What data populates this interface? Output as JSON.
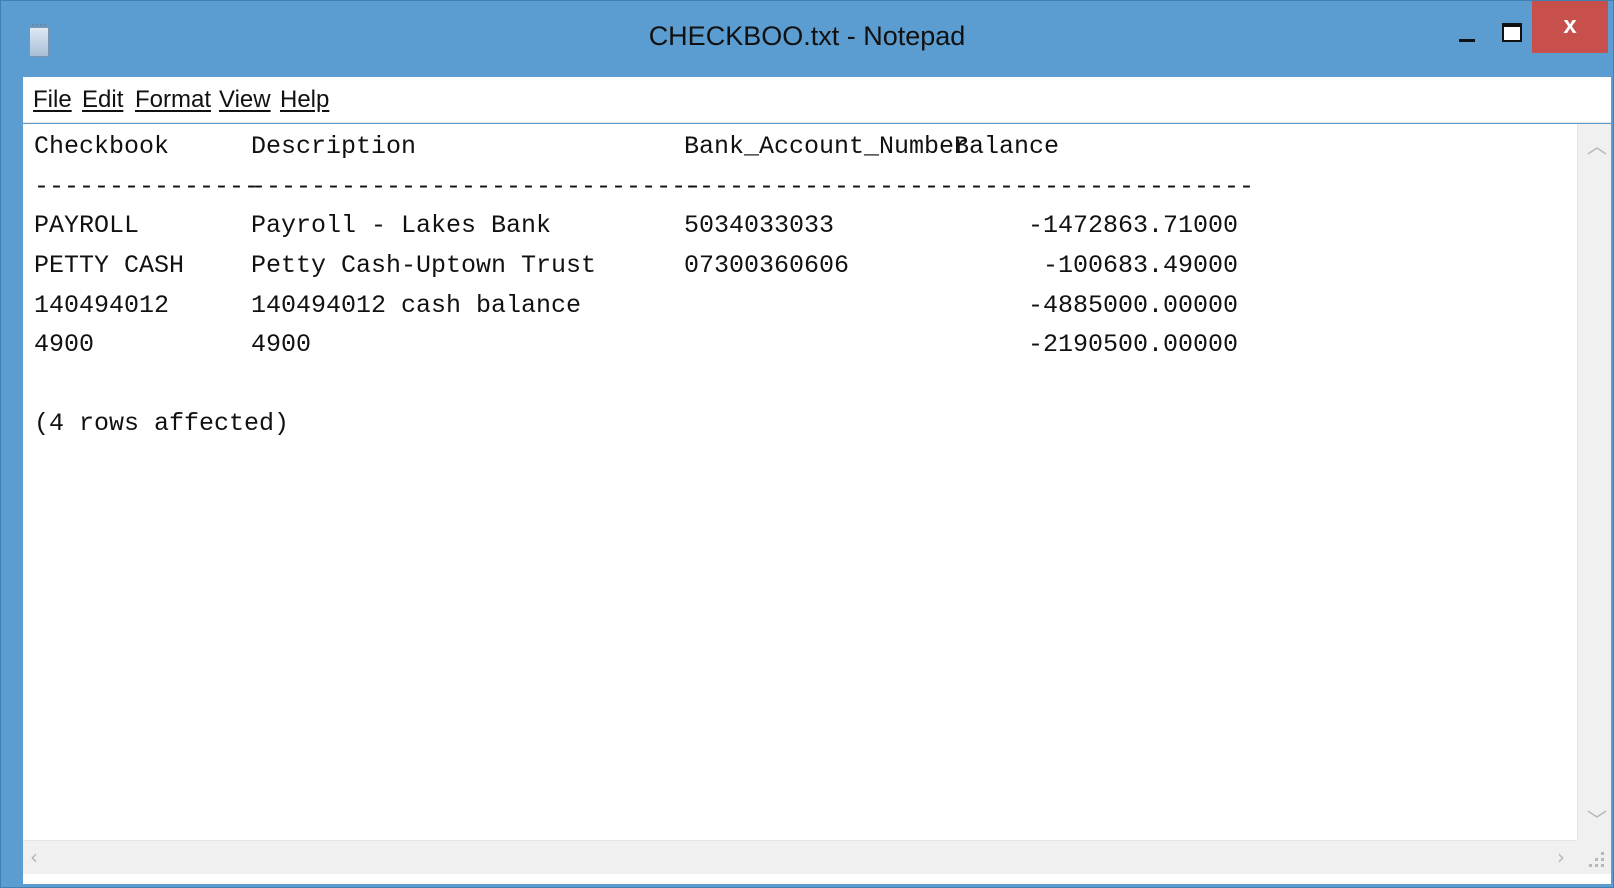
{
  "window": {
    "title": "CHECKBOO.txt - Notepad",
    "close_label": "x"
  },
  "menu": {
    "file": "File",
    "edit": "Edit",
    "format": "Format",
    "view": "View",
    "help": "Help"
  },
  "document": {
    "headers": {
      "checkbook": "Checkbook",
      "description": "Description",
      "bank_account_number": "Bank_Account_Number",
      "balance": "Balance"
    },
    "separators": {
      "checkbook": "---------------",
      "description": "------------------------------",
      "bank_account_number": "-------------------",
      "balance": "--------------------"
    },
    "rows": [
      {
        "checkbook": "PAYROLL",
        "description": "Payroll - Lakes Bank",
        "bank_account_number": "5034033033",
        "balance": "-1472863.71000"
      },
      {
        "checkbook": "PETTY CASH",
        "description": "Petty Cash-Uptown Trust",
        "bank_account_number": "07300360606",
        "balance": "-100683.49000"
      },
      {
        "checkbook": "140494012",
        "description": "140494012 cash balance",
        "bank_account_number": "",
        "balance": "-4885000.00000"
      },
      {
        "checkbook": "4900",
        "description": "4900",
        "bank_account_number": "",
        "balance": "-2190500.00000"
      }
    ],
    "footer": "(4 rows affected)"
  },
  "colors": {
    "titlebar": "#5b9dd0",
    "close_button": "#c7504d",
    "text": "#111111"
  },
  "icons": {
    "app": "notepad-icon",
    "minimize": "minimize-icon",
    "maximize": "maximize-icon",
    "close": "close-icon"
  }
}
